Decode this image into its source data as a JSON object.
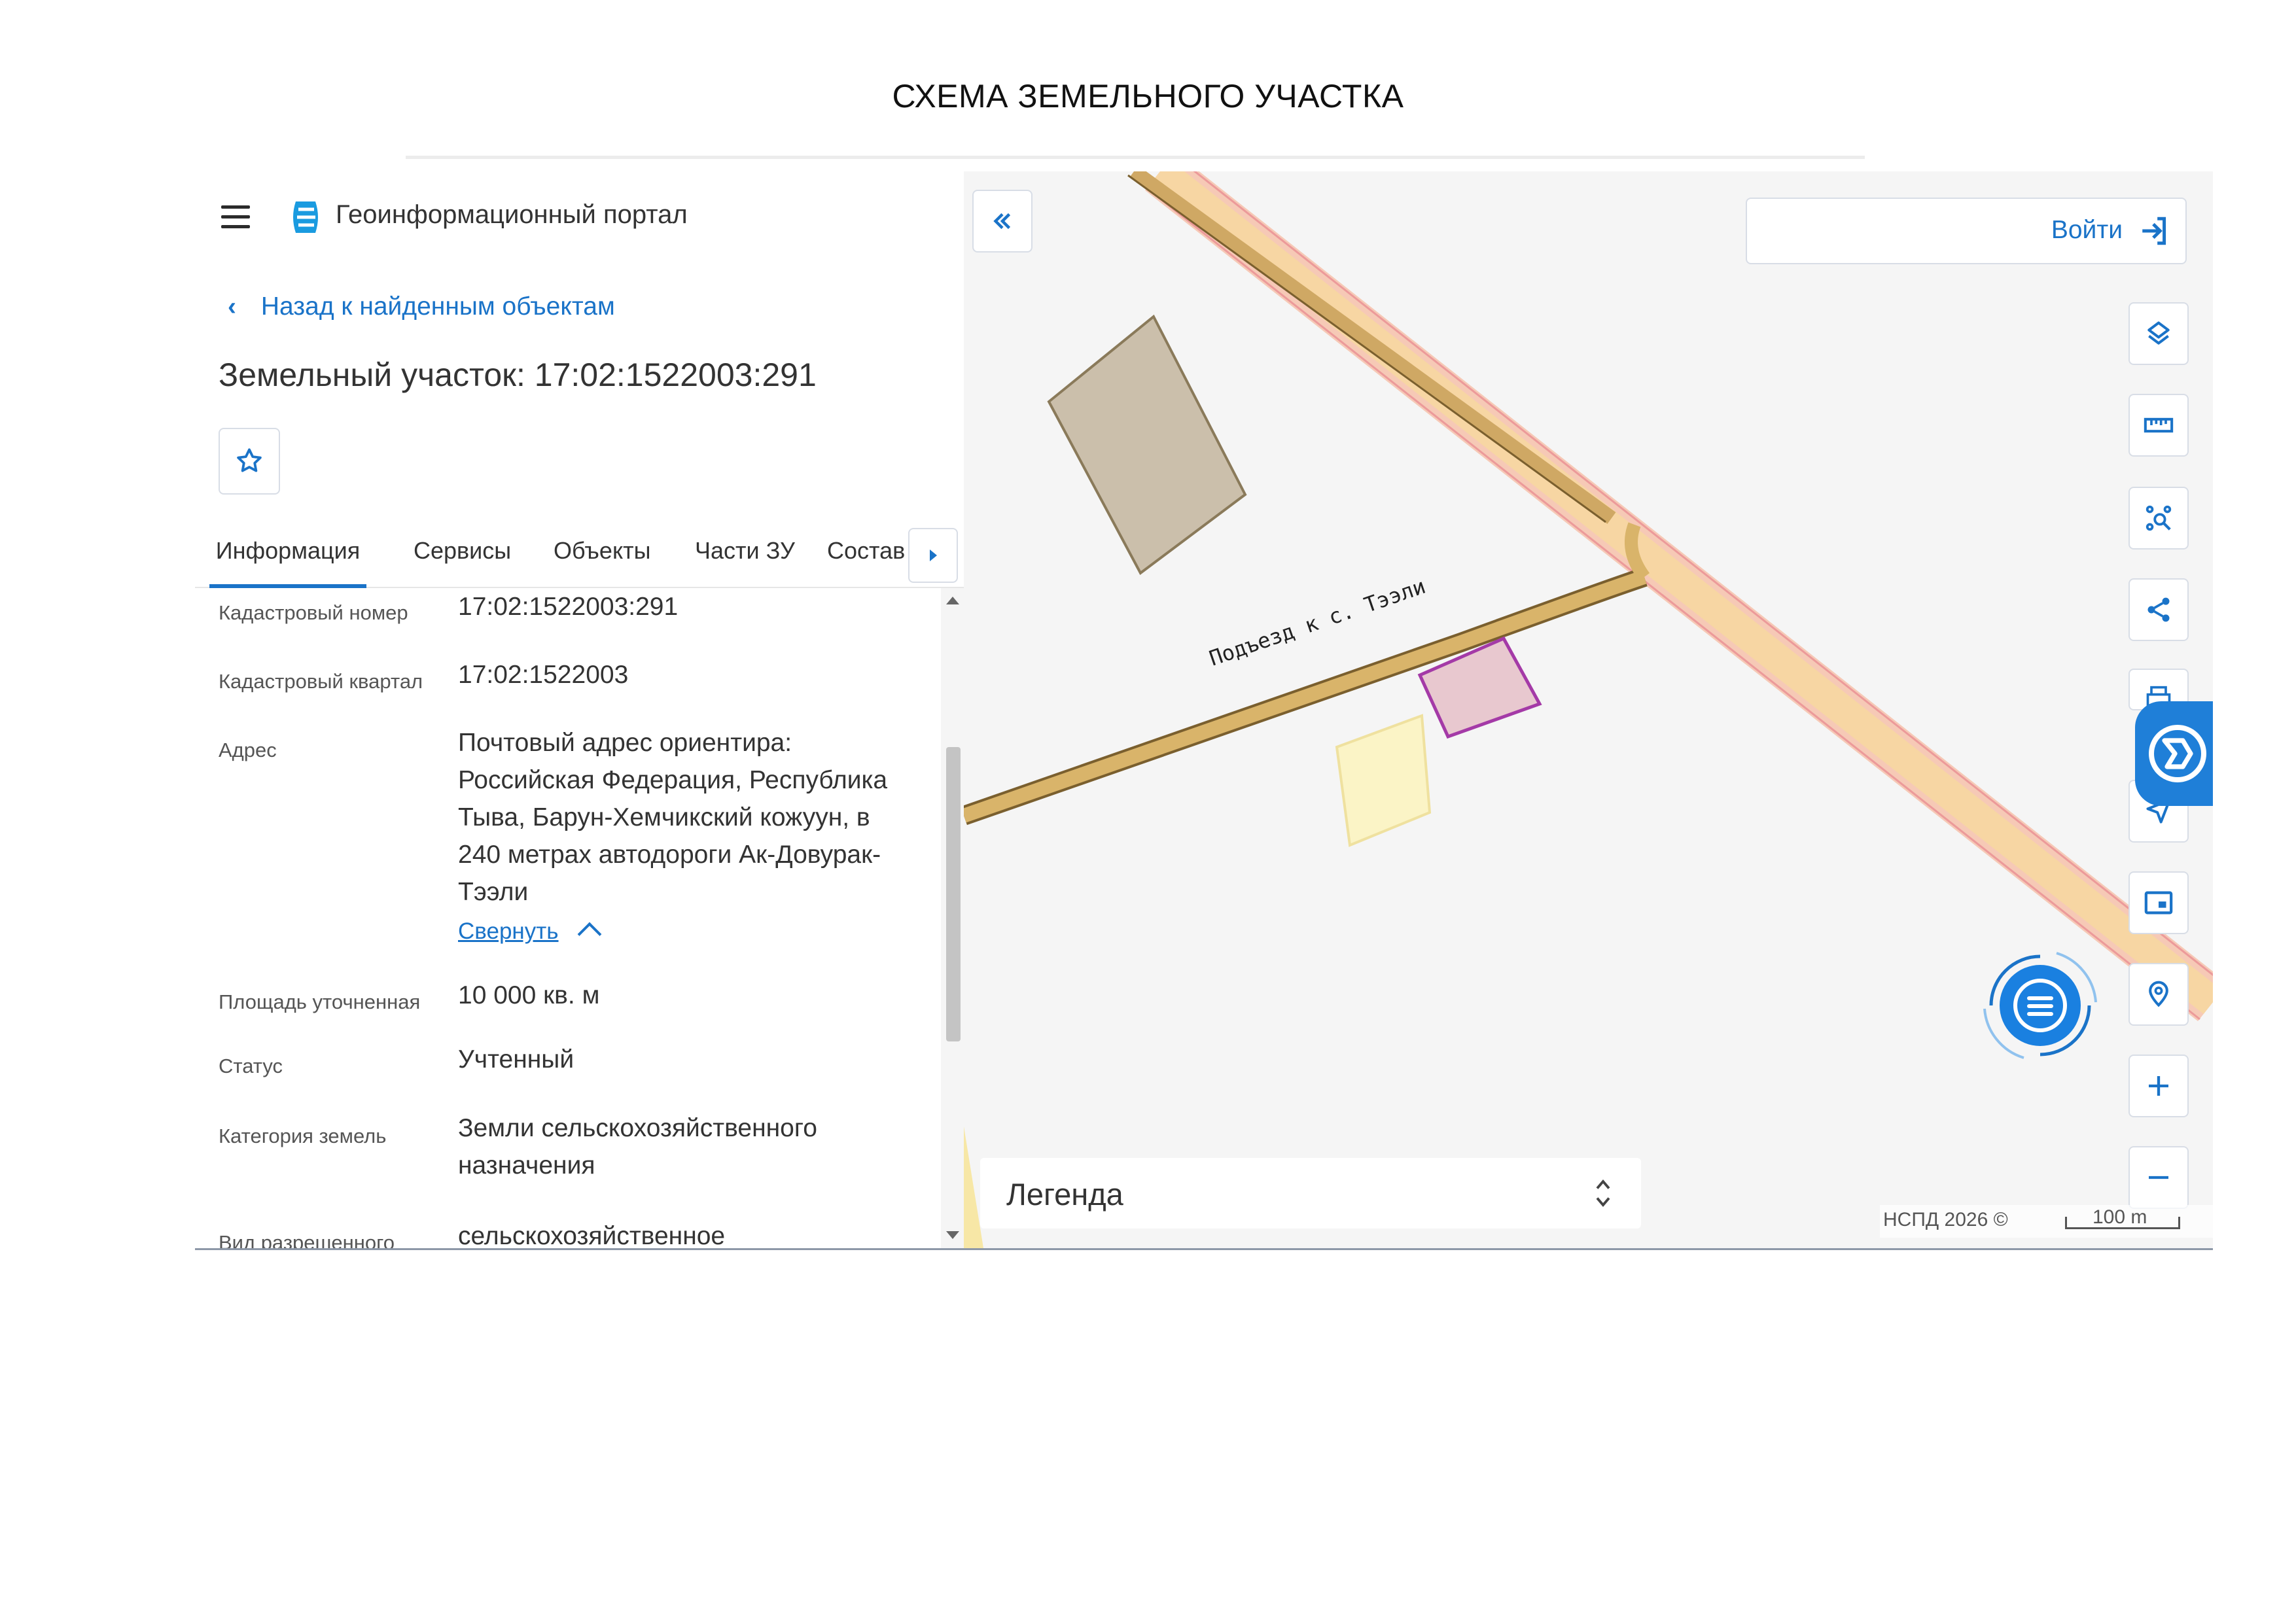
{
  "document": {
    "title": "СХЕМА ЗЕМЕЛЬНОГО УЧАСТКА"
  },
  "header": {
    "app_title": "Геоинформационный портал"
  },
  "navigation": {
    "back_label": "Назад к найденным объектам"
  },
  "object": {
    "title": "Земельный участок: 17:02:1522003:291"
  },
  "tabs": [
    {
      "label": "Информация",
      "active": true
    },
    {
      "label": "Сервисы",
      "active": false
    },
    {
      "label": "Объекты",
      "active": false
    },
    {
      "label": "Части ЗУ",
      "active": false
    },
    {
      "label": "Состав",
      "active": false
    }
  ],
  "info": {
    "rows": [
      {
        "label": "Кадастровый номер",
        "value": "17:02:1522003:291"
      },
      {
        "label": "Кадастровый квартал",
        "value": "17:02:1522003"
      },
      {
        "label": "Адрес",
        "value_lines": [
          "Почтовый адрес ориентира:",
          "Российская Федерация, Республика",
          "Тыва, Барун-Хемчикский кожуун, в",
          "240 метрах автодороги Ак-Довурак-",
          "Тээли"
        ]
      },
      {
        "label": "Площадь уточненная",
        "value": "10 000 кв. м"
      },
      {
        "label": "Статус",
        "value": "Учтенный"
      },
      {
        "label": "Категория земель",
        "value_lines": [
          "Земли сельскохозяйственного",
          "назначения"
        ]
      },
      {
        "label": "Вид разрешенного",
        "value": "сельскохозяйственное"
      }
    ],
    "collapse_label": "Свернуть"
  },
  "map": {
    "login_label": "Войти",
    "road_label": "Подъезд к с. Тээли",
    "legend_label": "Легенда",
    "attribution": "НСПД 2026 ©",
    "scale_label": "100 m",
    "tools": [
      "layers-icon",
      "ruler-icon",
      "select-area-icon",
      "share-icon",
      "print-icon",
      "navigation-icon",
      "picture-in-picture-icon",
      "location-pin-icon",
      "zoom-in-icon",
      "zoom-out-icon"
    ]
  },
  "colors": {
    "accent": "#1a73c8",
    "road": "#d9b46a",
    "parcel_selected": "#a43aa7",
    "parcel_gray": "#cbbfab",
    "parcel_yellow": "#fbf4c6"
  }
}
